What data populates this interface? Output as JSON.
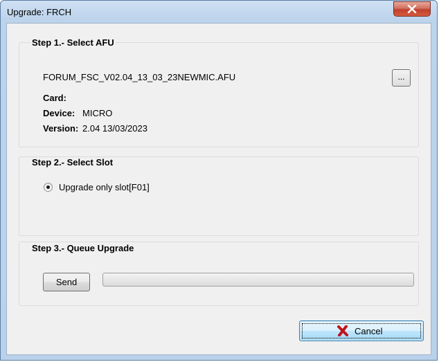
{
  "window": {
    "title": "Upgrade: FRCH"
  },
  "step1": {
    "legend": "Step 1.- Select AFU",
    "filename": "FORUM_FSC_V02.04_13_03_23NEWMIC.AFU",
    "browse_label": "...",
    "card_label": "Card:",
    "card_value": "",
    "device_label": "Device:",
    "device_value": "MICRO",
    "version_label": "Version:",
    "version_value": "2.04 13/03/2023"
  },
  "step2": {
    "legend": "Step 2.- Select Slot",
    "radio_label": "Upgrade only slot[F01]",
    "radio_selected": true
  },
  "step3": {
    "legend": "Step 3.- Queue Upgrade",
    "send_label": "Send",
    "progress": 0
  },
  "footer": {
    "cancel_label": "Cancel"
  },
  "colors": {
    "cancel_icon": "#c0141b",
    "accent": "#3c7fb1"
  },
  "icons": {
    "close": "close-x-icon",
    "cancel": "red-x-icon"
  }
}
